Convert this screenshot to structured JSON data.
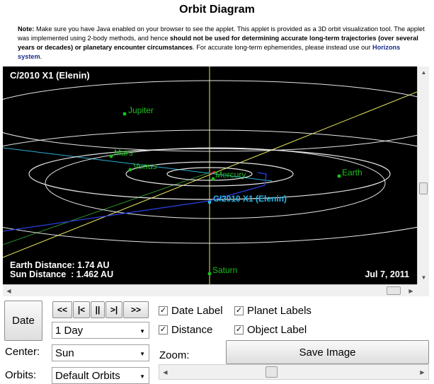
{
  "page": {
    "title": "Orbit Diagram",
    "note_prefix": "Note:",
    "note_1": " Make sure you have Java enabled on your browser to see the applet. This applet is provided as a 3D orbit visualization tool. The applet was implemented using 2-body methods, and hence ",
    "note_bold": "should not be used for determining accurate long-term trajectories (over several years or decades) or planetary encounter circumstances",
    "note_2": ". For accurate long-term ephemerides, please instead use our ",
    "note_link": "Horizons system",
    "note_end": "."
  },
  "applet": {
    "object_title": "C/2010 X1 (Elenin)",
    "earth_distance": "Earth Distance: 1.74 AU",
    "sun_distance": "Sun Distance  : 1.462 AU",
    "date_display": "Jul 7, 2011",
    "planets": {
      "jupiter": "Jupiter",
      "mars": "Mars",
      "venus": "Venus",
      "mercury": "Mercury",
      "earth": "Earth",
      "saturn": "Saturn"
    },
    "object_label": "C/2010 X1 (Elenin)",
    "colors": {
      "background": "#000000",
      "planet_label": "#1bbf1b",
      "object_label": "#29b6e6",
      "orbit_line": "#e6e6e6",
      "comet_orbit": "#2a3ee0",
      "axis_line": "#e8e85a",
      "text": "#ffffff"
    }
  },
  "controls": {
    "date_button": "Date",
    "nav_buttons": [
      "<<",
      "|<",
      "||",
      ">|",
      ">>"
    ],
    "step_select": "1 Day",
    "center_label": "Center:",
    "center_select": "Sun",
    "orbits_label": "Orbits:",
    "orbits_select": "Default Orbits",
    "zoom_label": "Zoom:",
    "save_button": "Save Image",
    "checkboxes": {
      "date_label": "Date Label",
      "planet_labels": "Planet Labels",
      "distance": "Distance",
      "object_label": "Object Label"
    },
    "check_mark": "✓"
  }
}
